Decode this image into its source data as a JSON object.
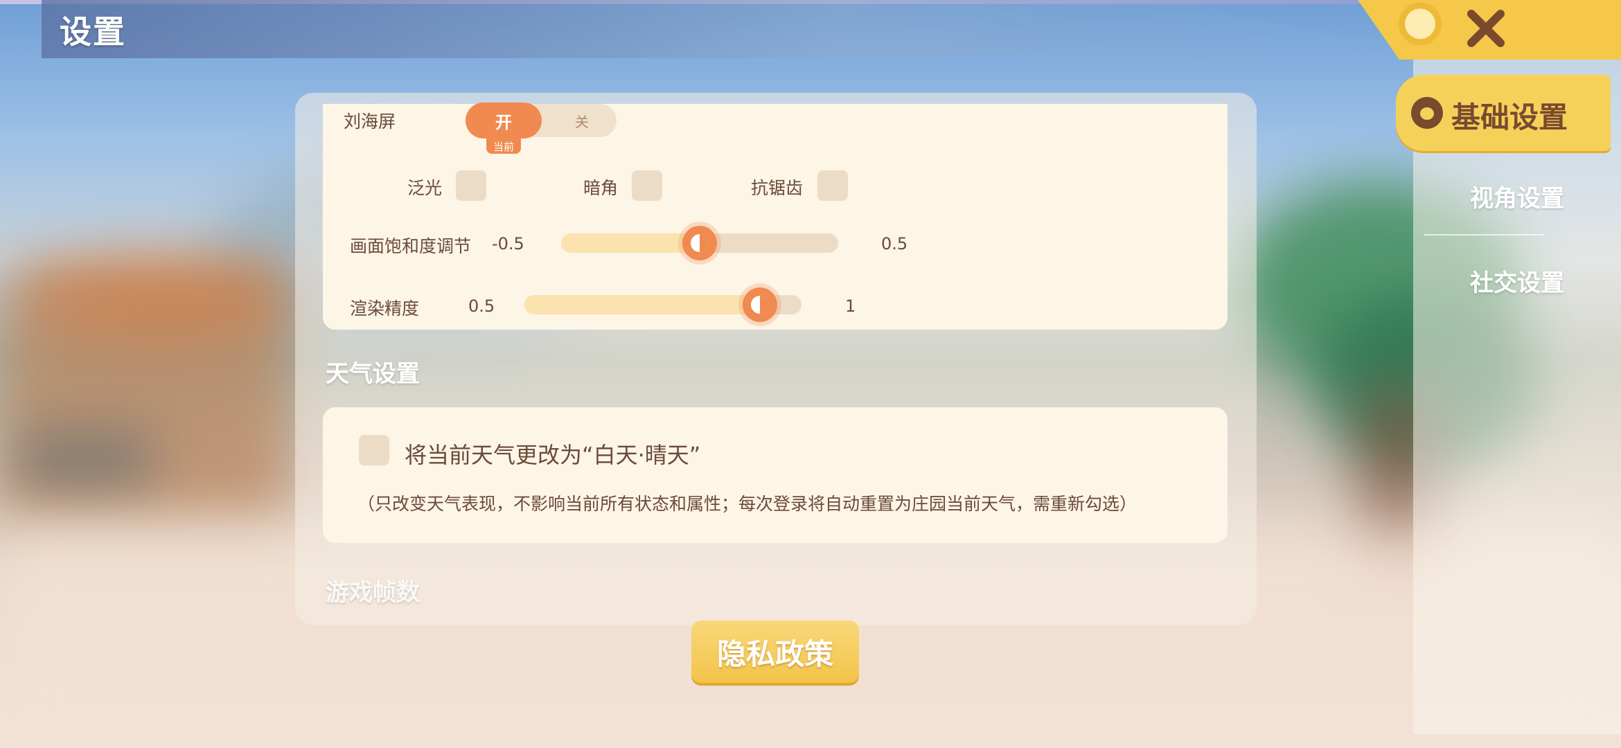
{
  "header": {
    "title": "设置"
  },
  "sidebar": {
    "items": [
      {
        "label": "基础设置",
        "active": true
      },
      {
        "label": "视角设置",
        "active": false
      },
      {
        "label": "社交设置",
        "active": false
      }
    ]
  },
  "display": {
    "notch": {
      "label": "刘海屏",
      "on_label": "开",
      "off_label": "关",
      "current_tag": "当前",
      "selected": "on"
    },
    "checks": [
      {
        "label": "泛光",
        "checked": false
      },
      {
        "label": "暗角",
        "checked": false
      },
      {
        "label": "抗锯齿",
        "checked": false
      }
    ],
    "saturation": {
      "label": "画面饱和度调节",
      "min": "-0.5",
      "max": "0.5",
      "level": 0.5
    },
    "render": {
      "label": "渲染精度",
      "min": "0.5",
      "max": "1",
      "level": 0.85
    }
  },
  "weather": {
    "title": "天气设置",
    "checkbox_label": "将当前天气更改为“白天·晴天”",
    "checked": false,
    "note": "（只改变天气表现，不影响当前所有状态和属性；每次登录将自动重置为庄园当前天气，需重新勾选）"
  },
  "fps": {
    "title": "游戏帧数"
  },
  "privacy_button": "隐私政策",
  "colors": {
    "accent_orange": "#f08a50",
    "accent_yellow": "#f6d15a",
    "card_bg": "#fdf5e6",
    "text_brown": "#6b4a3a"
  },
  "icons": {
    "close": "close-icon",
    "tab": "paw-icon"
  }
}
